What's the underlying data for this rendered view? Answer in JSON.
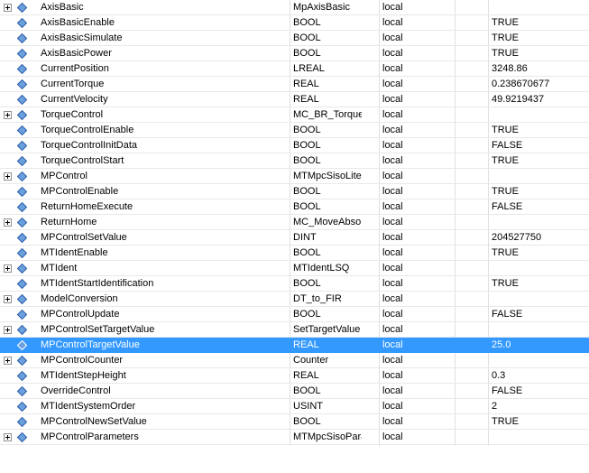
{
  "variables": [
    {
      "name": "AxisBasic",
      "type": "MpAxisBasic",
      "scope": "local",
      "value": "",
      "expandable": true
    },
    {
      "name": "AxisBasicEnable",
      "type": "BOOL",
      "scope": "local",
      "value": "TRUE",
      "expandable": false
    },
    {
      "name": "AxisBasicSimulate",
      "type": "BOOL",
      "scope": "local",
      "value": "TRUE",
      "expandable": false
    },
    {
      "name": "AxisBasicPower",
      "type": "BOOL",
      "scope": "local",
      "value": "TRUE",
      "expandable": false
    },
    {
      "name": "CurrentPosition",
      "type": "LREAL",
      "scope": "local",
      "value": "3248.86",
      "expandable": false
    },
    {
      "name": "CurrentTorque",
      "type": "REAL",
      "scope": "local",
      "value": "0.238670677",
      "expandable": false
    },
    {
      "name": "CurrentVelocity",
      "type": "REAL",
      "scope": "local",
      "value": "49.9219437",
      "expandable": false
    },
    {
      "name": "TorqueControl",
      "type": "MC_BR_Torque",
      "scope": "local",
      "value": "",
      "expandable": true
    },
    {
      "name": "TorqueControlEnable",
      "type": "BOOL",
      "scope": "local",
      "value": "TRUE",
      "expandable": false
    },
    {
      "name": "TorqueControlInitData",
      "type": "BOOL",
      "scope": "local",
      "value": "FALSE",
      "expandable": false
    },
    {
      "name": "TorqueControlStart",
      "type": "BOOL",
      "scope": "local",
      "value": "TRUE",
      "expandable": false
    },
    {
      "name": "MPControl",
      "type": "MTMpcSisoLite",
      "scope": "local",
      "value": "",
      "expandable": true
    },
    {
      "name": "MPControlEnable",
      "type": "BOOL",
      "scope": "local",
      "value": "TRUE",
      "expandable": false
    },
    {
      "name": "ReturnHomeExecute",
      "type": "BOOL",
      "scope": "local",
      "value": "FALSE",
      "expandable": false
    },
    {
      "name": "ReturnHome",
      "type": "MC_MoveAbsolu",
      "scope": "local",
      "value": "",
      "expandable": true
    },
    {
      "name": "MPControlSetValue",
      "type": "DINT",
      "scope": "local",
      "value": "204527750",
      "expandable": false
    },
    {
      "name": "MTIdentEnable",
      "type": "BOOL",
      "scope": "local",
      "value": "TRUE",
      "expandable": false
    },
    {
      "name": "MTIdent",
      "type": "MTIdentLSQ",
      "scope": "local",
      "value": "",
      "expandable": true
    },
    {
      "name": "MTIdentStartIdentification",
      "type": "BOOL",
      "scope": "local",
      "value": "TRUE",
      "expandable": false
    },
    {
      "name": "ModelConversion",
      "type": "DT_to_FIR",
      "scope": "local",
      "value": "",
      "expandable": true
    },
    {
      "name": "MPControlUpdate",
      "type": "BOOL",
      "scope": "local",
      "value": "FALSE",
      "expandable": false
    },
    {
      "name": "MPControlSetTargetValue",
      "type": "SetTargetValue",
      "scope": "local",
      "value": "",
      "expandable": true
    },
    {
      "name": "MPControlTargetValue",
      "type": "REAL",
      "scope": "local",
      "value": "25.0",
      "expandable": false,
      "selected": true
    },
    {
      "name": "MPControlCounter",
      "type": "Counter",
      "scope": "local",
      "value": "",
      "expandable": true
    },
    {
      "name": "MTIdentStepHeight",
      "type": "REAL",
      "scope": "local",
      "value": "0.3",
      "expandable": false
    },
    {
      "name": "OverrideControl",
      "type": "BOOL",
      "scope": "local",
      "value": "FALSE",
      "expandable": false
    },
    {
      "name": "MTIdentSystemOrder",
      "type": "USINT",
      "scope": "local",
      "value": "2",
      "expandable": false
    },
    {
      "name": "MPControlNewSetValue",
      "type": "BOOL",
      "scope": "local",
      "value": "TRUE",
      "expandable": false
    },
    {
      "name": "MPControlParameters",
      "type": "MTMpcSisoPara",
      "scope": "local",
      "value": "",
      "expandable": true
    }
  ],
  "icons": {
    "variable": "variable-icon",
    "expand": "expand-plus-icon"
  },
  "colors": {
    "selection": "#3399ff",
    "icon_fill": "#6aa0de",
    "icon_stroke": "#2e5fa8"
  }
}
